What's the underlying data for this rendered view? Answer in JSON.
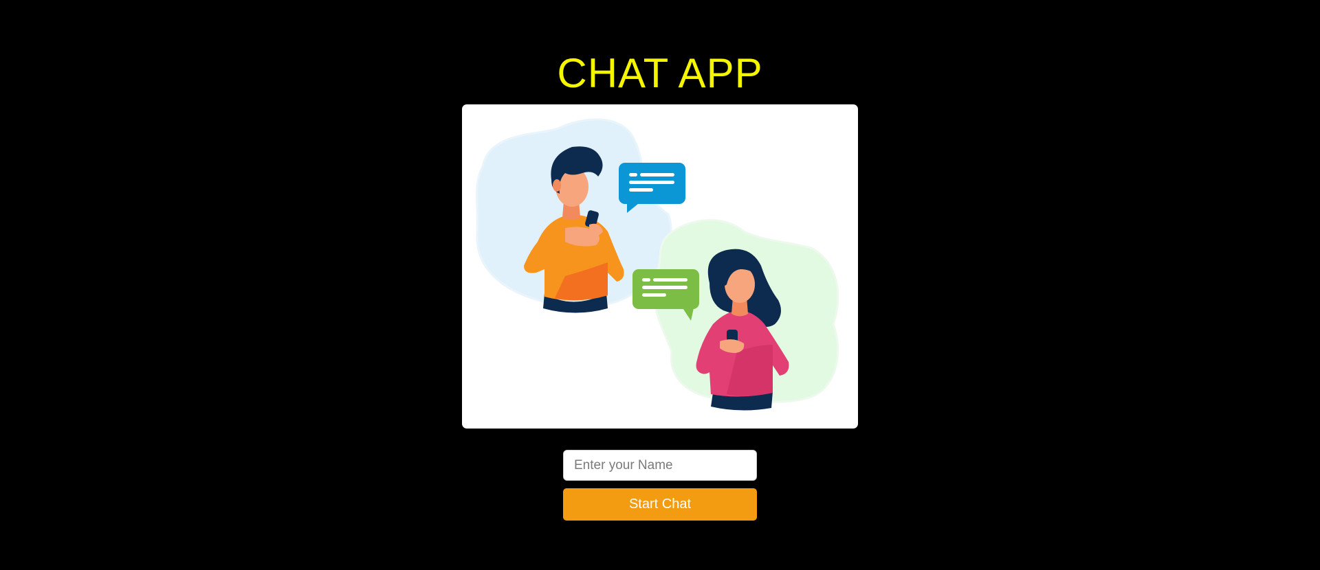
{
  "app": {
    "title": "CHAT APP"
  },
  "form": {
    "name_placeholder": "Enter your Name",
    "name_value": "",
    "start_label": "Start Chat"
  },
  "colors": {
    "background": "#000000",
    "title": "#f5f500",
    "button": "#f39c12",
    "card": "#ffffff",
    "bubble_blue": "#0b96d6",
    "bubble_green": "#7cbd45",
    "sweater_orange": "#f7941d",
    "sweater_pink": "#e23f74",
    "hair": "#0d2b4e",
    "skin": "#f7a57c"
  },
  "illustration": {
    "icon": "chat-people-illustration"
  }
}
